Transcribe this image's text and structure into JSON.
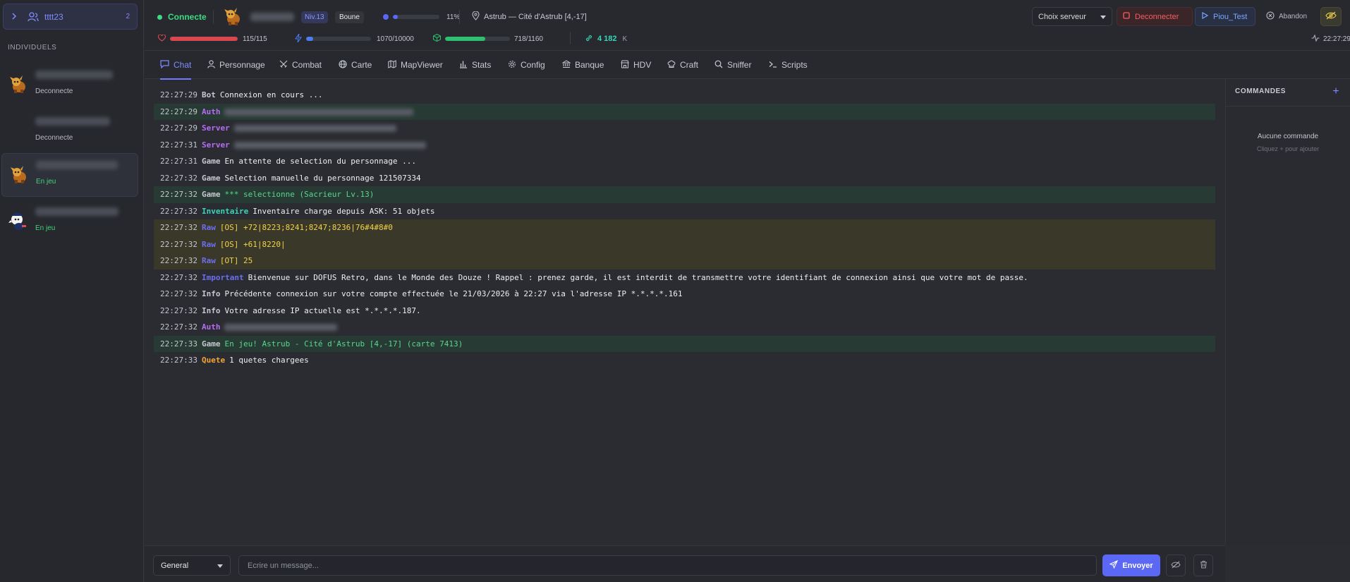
{
  "group": {
    "name": "tttt23",
    "count": "2"
  },
  "sidebar": {
    "section_label": "INDIVIDUELS",
    "accounts": [
      {
        "status": "Deconnecte",
        "state": "off"
      },
      {
        "status": "Deconnecte",
        "state": "off"
      },
      {
        "status": "En jeu",
        "state": "on",
        "selected": true
      },
      {
        "status": "En jeu",
        "state": "on"
      }
    ]
  },
  "header": {
    "connection": "Connecte",
    "level": "Niv.13",
    "tag": "Boune",
    "xp_percent_label": "11%",
    "xp_fraction": 0.11,
    "location": "Astrub — Cité d'Astrub [4,-17]",
    "server_placeholder": "Choix serveur",
    "disconnect_label": "Deconnecter",
    "profile_label": "Piou_Test",
    "abandon_label": "Abandon",
    "hp_label": "115/115",
    "hp_fraction": 1.0,
    "energy_label": "1070/10000",
    "energy_fraction": 0.107,
    "pods_label": "718/1160",
    "pods_fraction": 0.619,
    "kamas_value": "4 182",
    "kamas_unit": "K",
    "clock": "22:27:29",
    "colors": {
      "connected": "#3ddc84",
      "hp": "#d9474f",
      "energy": "#4d7cf5",
      "pods": "#2fbf71",
      "kamas": "#37d6b8"
    }
  },
  "tabs": [
    "Chat",
    "Personnage",
    "Combat",
    "Carte",
    "MapViewer",
    "Stats",
    "Config",
    "Banque",
    "HDV",
    "Craft",
    "Sniffer",
    "Scripts"
  ],
  "chat_lines": [
    {
      "time": "22:27:29",
      "source": "Bot",
      "text": "Connexion en cours ...",
      "src_color": "#c5c8cf",
      "msg_color": "#eeeff2",
      "bg": ""
    },
    {
      "time": "22:27:29",
      "source": "Auth",
      "text": "",
      "src_color": "#b66cf5",
      "msg_color": "#eeeff2",
      "bg": "hl-green",
      "redacted": true
    },
    {
      "time": "22:27:29",
      "source": "Server",
      "text": "",
      "src_color": "#b66cf5",
      "msg_color": "#eeeff2",
      "bg": "",
      "redacted": true
    },
    {
      "time": "22:27:31",
      "source": "Server",
      "text": "",
      "src_color": "#b66cf5",
      "msg_color": "#eeeff2",
      "bg": "",
      "redacted": true
    },
    {
      "time": "22:27:31",
      "source": "Game",
      "text": "En attente de selection du personnage ...",
      "src_color": "#c5c8cf",
      "msg_color": "#eeeff2",
      "bg": ""
    },
    {
      "time": "22:27:32",
      "source": "Game",
      "text": "Selection manuelle du personnage 121507334",
      "src_color": "#c5c8cf",
      "msg_color": "#eeeff2",
      "bg": ""
    },
    {
      "time": "22:27:32",
      "source": "Game",
      "text": "*** selectionne (Sacrieur Lv.13)",
      "src_color": "#c5c8cf",
      "msg_color": "#58d68d",
      "bg": "hl-green"
    },
    {
      "time": "22:27:32",
      "source": "Inventaire",
      "text": "Inventaire charge depuis ASK: 51 objets",
      "src_color": "#37d6b8",
      "msg_color": "#eeeff2",
      "bg": ""
    },
    {
      "time": "22:27:32",
      "source": "Raw",
      "text": "[OS] +72|8223;8241;8247;8236|76#4#8#0",
      "src_color": "#6b6ff0",
      "msg_color": "#f2d24b",
      "bg": "hl-yellow"
    },
    {
      "time": "22:27:32",
      "source": "Raw",
      "text": "[OS] +61|8220|",
      "src_color": "#6b6ff0",
      "msg_color": "#f2d24b",
      "bg": "hl-yellow"
    },
    {
      "time": "22:27:32",
      "source": "Raw",
      "text": "[OT] 25",
      "src_color": "#6b6ff0",
      "msg_color": "#f2d24b",
      "bg": "hl-yellow"
    },
    {
      "time": "22:27:32",
      "source": "Important",
      "text": "Bienvenue sur DOFUS Retro, dans le Monde des Douze ! Rappel : prenez garde, il est interdit de transmettre votre identifiant de connexion ainsi que votre mot de passe.",
      "src_color": "#6b6ff0",
      "msg_color": "#eeeff2",
      "bg": ""
    },
    {
      "time": "22:27:32",
      "source": "Info",
      "text": "Précédente connexion sur votre compte effectuée le 21/03/2026 à 22:27 via l'adresse IP *.*.*.*.161",
      "src_color": "#c5c8cf",
      "msg_color": "#eeeff2",
      "bg": ""
    },
    {
      "time": "22:27:32",
      "source": "Info",
      "text": "Votre adresse IP actuelle est *.*.*.*.187.",
      "src_color": "#c5c8cf",
      "msg_color": "#eeeff2",
      "bg": ""
    },
    {
      "time": "22:27:32",
      "source": "Auth",
      "text": "",
      "src_color": "#b66cf5",
      "msg_color": "#eeeff2",
      "bg": "",
      "redacted": true
    },
    {
      "time": "22:27:33",
      "source": "Game",
      "text": "En jeu! Astrub - Cité d'Astrub [4,-17] (carte 7413)",
      "src_color": "#c5c8cf",
      "msg_color": "#58d68d",
      "bg": "hl-green"
    },
    {
      "time": "22:27:33",
      "source": "Quete",
      "text": "1 quetes chargees",
      "src_color": "#f2a33a",
      "msg_color": "#eeeff2",
      "bg": ""
    }
  ],
  "commands": {
    "title": "COMMANDES",
    "empty": "Aucune commande",
    "hint": "Cliquez + pour ajouter"
  },
  "composer": {
    "channel": "General",
    "placeholder": "Ecrire un message...",
    "send_label": "Envoyer"
  }
}
